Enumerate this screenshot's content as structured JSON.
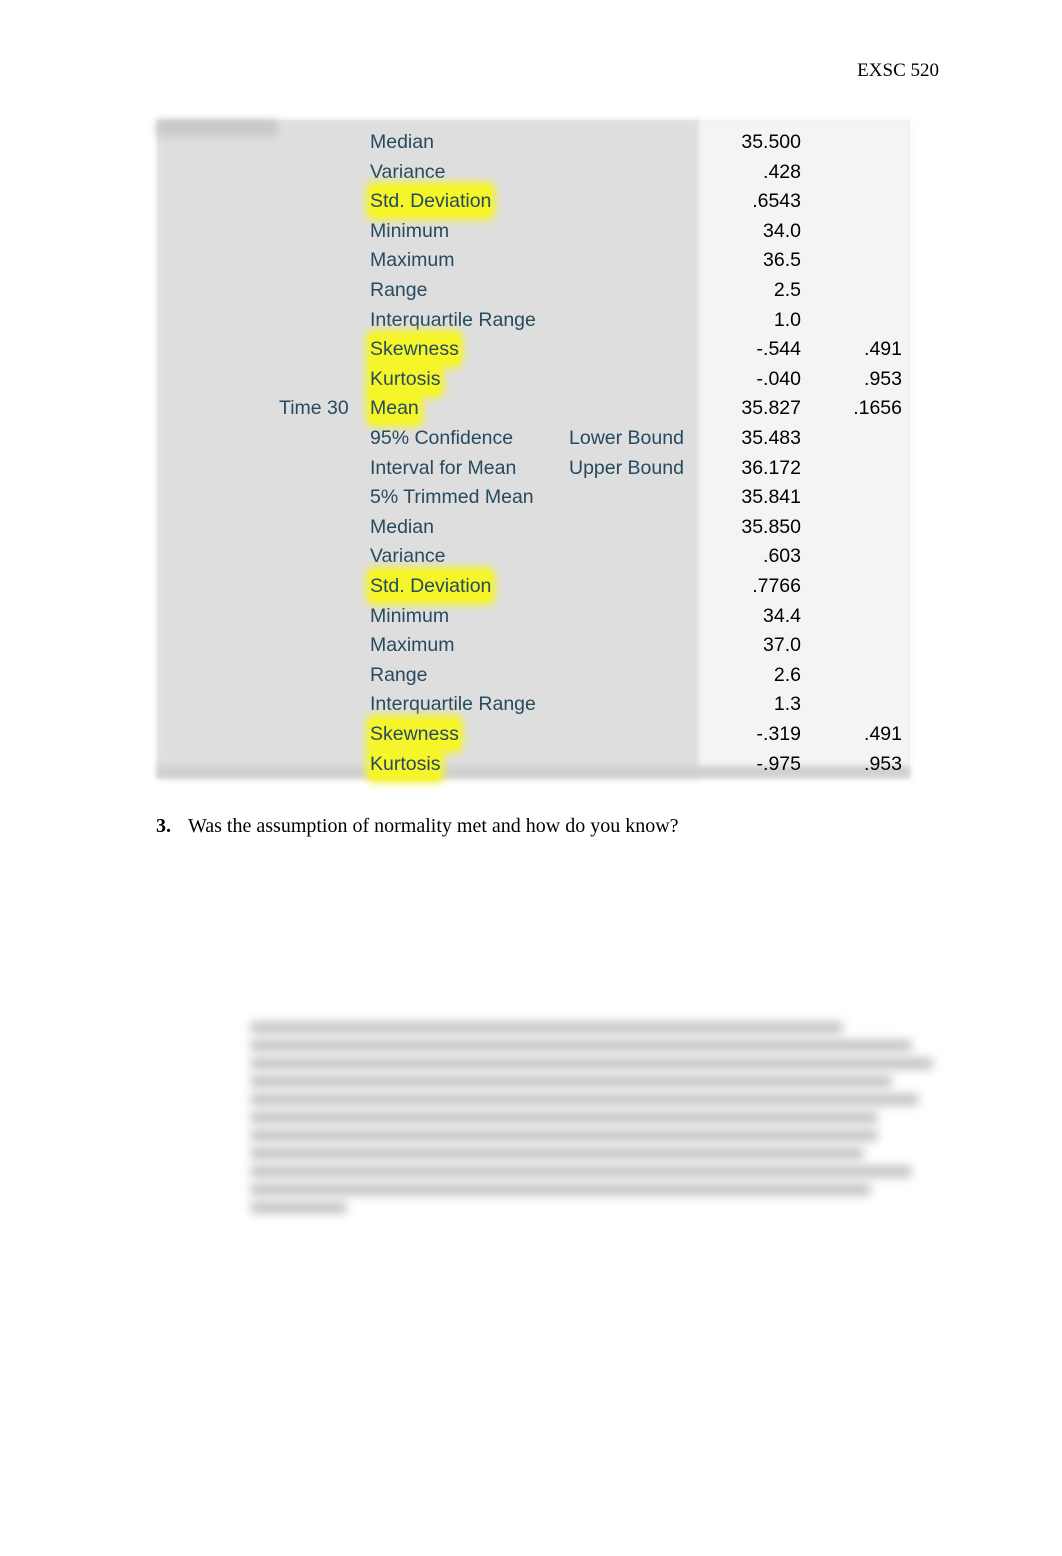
{
  "header": {
    "course": "EXSC 520"
  },
  "table": {
    "rows": [
      {
        "group": "",
        "stat": "Median",
        "sub": "",
        "value": "35.500",
        "se": "",
        "highlight": false
      },
      {
        "group": "",
        "stat": "Variance",
        "sub": "",
        "value": ".428",
        "se": "",
        "highlight": false
      },
      {
        "group": "",
        "stat": "Std. Deviation",
        "sub": "",
        "value": ".6543",
        "se": "",
        "highlight": true
      },
      {
        "group": "",
        "stat": "Minimum",
        "sub": "",
        "value": "34.0",
        "se": "",
        "highlight": false
      },
      {
        "group": "",
        "stat": "Maximum",
        "sub": "",
        "value": "36.5",
        "se": "",
        "highlight": false
      },
      {
        "group": "",
        "stat": "Range",
        "sub": "",
        "value": "2.5",
        "se": "",
        "highlight": false
      },
      {
        "group": "",
        "stat": "Interquartile Range",
        "sub": "",
        "value": "1.0",
        "se": "",
        "highlight": false
      },
      {
        "group": "",
        "stat": "Skewness",
        "sub": "",
        "value": "-.544",
        "se": ".491",
        "highlight": true
      },
      {
        "group": "",
        "stat": "Kurtosis",
        "sub": "",
        "value": "-.040",
        "se": ".953",
        "highlight": true
      },
      {
        "group": "Time 30",
        "stat": "Mean",
        "sub": "",
        "value": "35.827",
        "se": ".1656",
        "highlight": true
      },
      {
        "group": "",
        "stat": "95% Confidence",
        "sub": "Lower Bound",
        "value": "35.483",
        "se": "",
        "highlight": false
      },
      {
        "group": "",
        "stat": "Interval for Mean",
        "sub": "Upper Bound",
        "value": "36.172",
        "se": "",
        "highlight": false
      },
      {
        "group": "",
        "stat": "5% Trimmed Mean",
        "sub": "",
        "value": "35.841",
        "se": "",
        "highlight": false
      },
      {
        "group": "",
        "stat": "Median",
        "sub": "",
        "value": "35.850",
        "se": "",
        "highlight": false
      },
      {
        "group": "",
        "stat": "Variance",
        "sub": "",
        "value": ".603",
        "se": "",
        "highlight": false
      },
      {
        "group": "",
        "stat": "Std. Deviation",
        "sub": "",
        "value": ".7766",
        "se": "",
        "highlight": true
      },
      {
        "group": "",
        "stat": "Minimum",
        "sub": "",
        "value": "34.4",
        "se": "",
        "highlight": false
      },
      {
        "group": "",
        "stat": "Maximum",
        "sub": "",
        "value": "37.0",
        "se": "",
        "highlight": false
      },
      {
        "group": "",
        "stat": "Range",
        "sub": "",
        "value": "2.6",
        "se": "",
        "highlight": false
      },
      {
        "group": "",
        "stat": "Interquartile Range",
        "sub": "",
        "value": "1.3",
        "se": "",
        "highlight": false
      },
      {
        "group": "",
        "stat": "Skewness",
        "sub": "",
        "value": "-.319",
        "se": ".491",
        "highlight": true
      },
      {
        "group": "",
        "stat": "Kurtosis",
        "sub": "",
        "value": "-.975",
        "se": ".953",
        "highlight": true
      }
    ],
    "colors": {
      "label": "#264a60",
      "highlight": "#f5f52a"
    }
  },
  "question": {
    "number": "3.",
    "text": "Was the assumption of normality met and how do you know?"
  }
}
